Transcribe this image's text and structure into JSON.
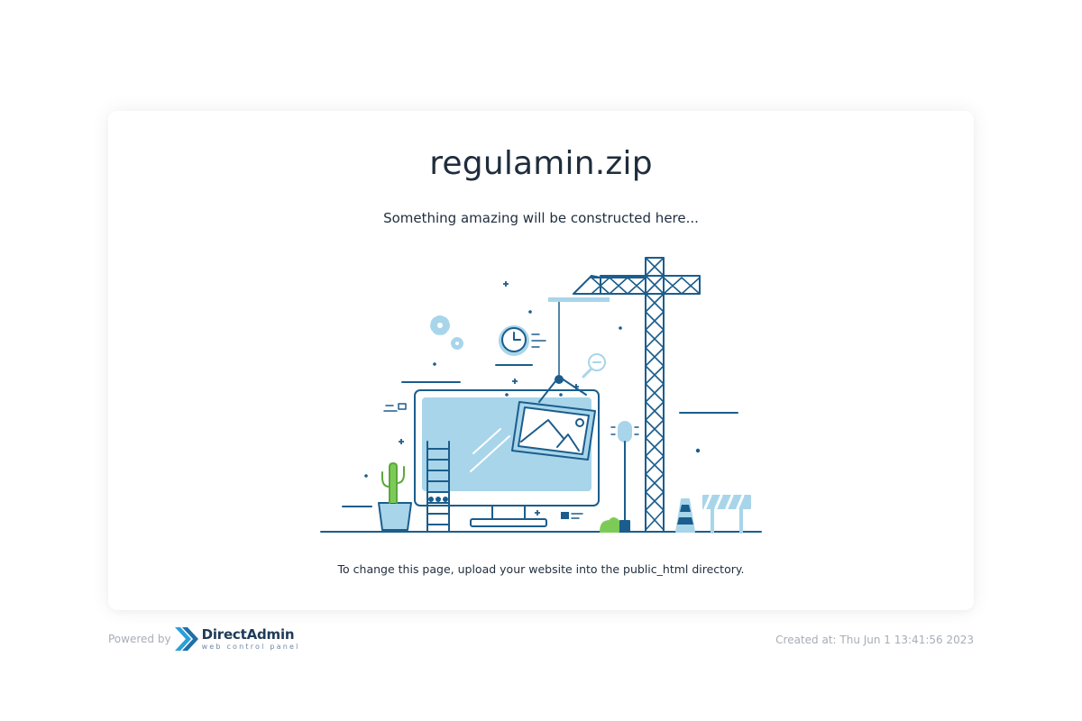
{
  "page": {
    "title": "regulamin.zip",
    "subtitle": "Something amazing will be constructed here...",
    "instruction": "To change this page, upload your website into the public_html directory."
  },
  "footer": {
    "powered_label": "Powered by",
    "brand_name": "DirectAdmin",
    "brand_tagline": "web control panel",
    "created_at": "Created at: Thu Jun 1 13:41:56 2023"
  },
  "colors": {
    "text": "#1f2d3d",
    "muted": "#a7aeb6",
    "navy": "#1b5d8c",
    "light_blue": "#a8d5ea",
    "green": "#7dcb57"
  }
}
